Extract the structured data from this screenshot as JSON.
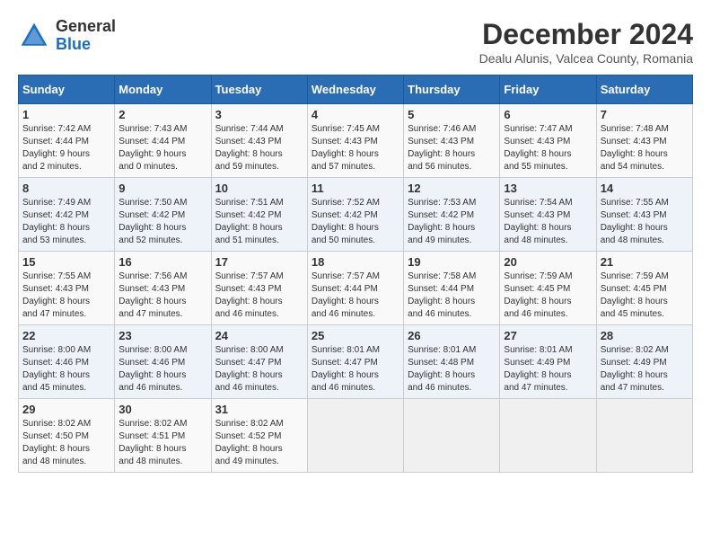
{
  "logo": {
    "line1": "General",
    "line2": "Blue"
  },
  "title": "December 2024",
  "subtitle": "Dealu Alunis, Valcea County, Romania",
  "days_of_week": [
    "Sunday",
    "Monday",
    "Tuesday",
    "Wednesday",
    "Thursday",
    "Friday",
    "Saturday"
  ],
  "weeks": [
    [
      {
        "day": "1",
        "sunrise": "7:42 AM",
        "sunset": "4:44 PM",
        "daylight": "9 hours and 2 minutes."
      },
      {
        "day": "2",
        "sunrise": "7:43 AM",
        "sunset": "4:44 PM",
        "daylight": "9 hours and 0 minutes."
      },
      {
        "day": "3",
        "sunrise": "7:44 AM",
        "sunset": "4:43 PM",
        "daylight": "8 hours and 59 minutes."
      },
      {
        "day": "4",
        "sunrise": "7:45 AM",
        "sunset": "4:43 PM",
        "daylight": "8 hours and 57 minutes."
      },
      {
        "day": "5",
        "sunrise": "7:46 AM",
        "sunset": "4:43 PM",
        "daylight": "8 hours and 56 minutes."
      },
      {
        "day": "6",
        "sunrise": "7:47 AM",
        "sunset": "4:43 PM",
        "daylight": "8 hours and 55 minutes."
      },
      {
        "day": "7",
        "sunrise": "7:48 AM",
        "sunset": "4:43 PM",
        "daylight": "8 hours and 54 minutes."
      }
    ],
    [
      {
        "day": "8",
        "sunrise": "7:49 AM",
        "sunset": "4:42 PM",
        "daylight": "8 hours and 53 minutes."
      },
      {
        "day": "9",
        "sunrise": "7:50 AM",
        "sunset": "4:42 PM",
        "daylight": "8 hours and 52 minutes."
      },
      {
        "day": "10",
        "sunrise": "7:51 AM",
        "sunset": "4:42 PM",
        "daylight": "8 hours and 51 minutes."
      },
      {
        "day": "11",
        "sunrise": "7:52 AM",
        "sunset": "4:42 PM",
        "daylight": "8 hours and 50 minutes."
      },
      {
        "day": "12",
        "sunrise": "7:53 AM",
        "sunset": "4:42 PM",
        "daylight": "8 hours and 49 minutes."
      },
      {
        "day": "13",
        "sunrise": "7:54 AM",
        "sunset": "4:43 PM",
        "daylight": "8 hours and 48 minutes."
      },
      {
        "day": "14",
        "sunrise": "7:55 AM",
        "sunset": "4:43 PM",
        "daylight": "8 hours and 48 minutes."
      }
    ],
    [
      {
        "day": "15",
        "sunrise": "7:55 AM",
        "sunset": "4:43 PM",
        "daylight": "8 hours and 47 minutes."
      },
      {
        "day": "16",
        "sunrise": "7:56 AM",
        "sunset": "4:43 PM",
        "daylight": "8 hours and 47 minutes."
      },
      {
        "day": "17",
        "sunrise": "7:57 AM",
        "sunset": "4:43 PM",
        "daylight": "8 hours and 46 minutes."
      },
      {
        "day": "18",
        "sunrise": "7:57 AM",
        "sunset": "4:44 PM",
        "daylight": "8 hours and 46 minutes."
      },
      {
        "day": "19",
        "sunrise": "7:58 AM",
        "sunset": "4:44 PM",
        "daylight": "8 hours and 46 minutes."
      },
      {
        "day": "20",
        "sunrise": "7:59 AM",
        "sunset": "4:45 PM",
        "daylight": "8 hours and 46 minutes."
      },
      {
        "day": "21",
        "sunrise": "7:59 AM",
        "sunset": "4:45 PM",
        "daylight": "8 hours and 45 minutes."
      }
    ],
    [
      {
        "day": "22",
        "sunrise": "8:00 AM",
        "sunset": "4:46 PM",
        "daylight": "8 hours and 45 minutes."
      },
      {
        "day": "23",
        "sunrise": "8:00 AM",
        "sunset": "4:46 PM",
        "daylight": "8 hours and 46 minutes."
      },
      {
        "day": "24",
        "sunrise": "8:00 AM",
        "sunset": "4:47 PM",
        "daylight": "8 hours and 46 minutes."
      },
      {
        "day": "25",
        "sunrise": "8:01 AM",
        "sunset": "4:47 PM",
        "daylight": "8 hours and 46 minutes."
      },
      {
        "day": "26",
        "sunrise": "8:01 AM",
        "sunset": "4:48 PM",
        "daylight": "8 hours and 46 minutes."
      },
      {
        "day": "27",
        "sunrise": "8:01 AM",
        "sunset": "4:49 PM",
        "daylight": "8 hours and 47 minutes."
      },
      {
        "day": "28",
        "sunrise": "8:02 AM",
        "sunset": "4:49 PM",
        "daylight": "8 hours and 47 minutes."
      }
    ],
    [
      {
        "day": "29",
        "sunrise": "8:02 AM",
        "sunset": "4:50 PM",
        "daylight": "8 hours and 48 minutes."
      },
      {
        "day": "30",
        "sunrise": "8:02 AM",
        "sunset": "4:51 PM",
        "daylight": "8 hours and 48 minutes."
      },
      {
        "day": "31",
        "sunrise": "8:02 AM",
        "sunset": "4:52 PM",
        "daylight": "8 hours and 49 minutes."
      },
      null,
      null,
      null,
      null
    ]
  ]
}
